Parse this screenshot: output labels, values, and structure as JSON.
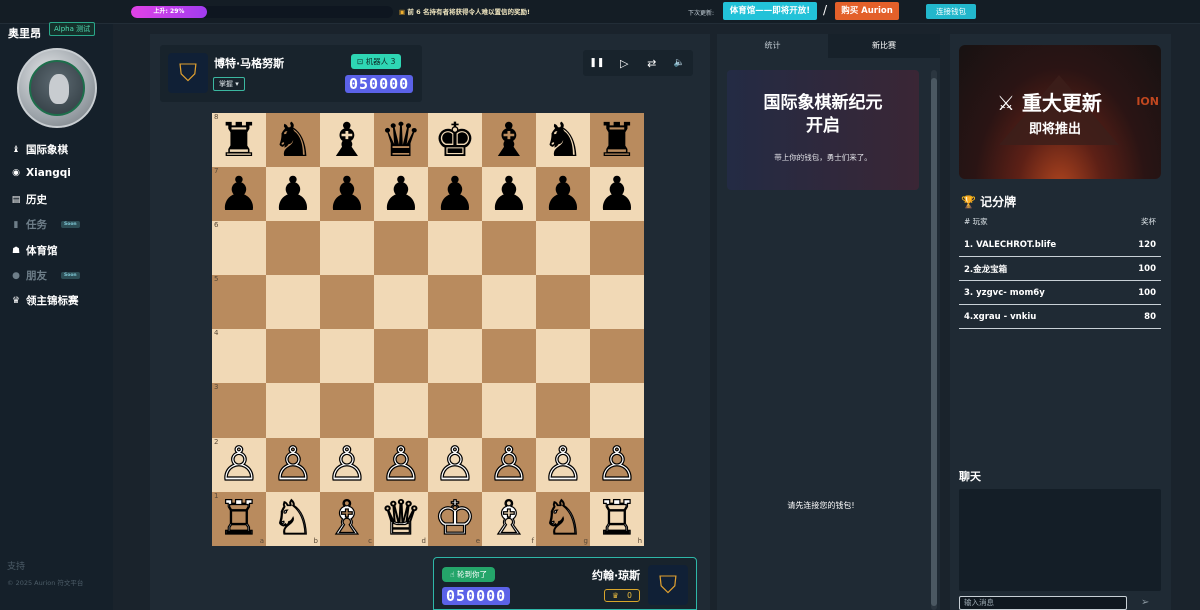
{
  "topbar": {
    "progress_label": "上升: 29%",
    "progress_value": 0.29,
    "notice": "前 6 名持有者将获得令人难以置信的奖励!",
    "next_update_label": "下次更新:",
    "gym_button": "体育馆——即将开放!",
    "slash": "/",
    "buy_button": "购买 Aurion",
    "connect_wallet": "连接钱包"
  },
  "sidebar": {
    "brand": "奥里昂",
    "alpha_badge": "Alpha 测试",
    "items": [
      {
        "icon": "♝",
        "label": "国际象棋",
        "dim": false
      },
      {
        "icon": "◉",
        "label": "Xiangqi",
        "dim": false
      },
      {
        "icon": "▤",
        "label": "历史",
        "dim": false
      },
      {
        "icon": "▮",
        "label": "任务",
        "dim": true,
        "soon": "Soon"
      },
      {
        "icon": "☗",
        "label": "体育馆",
        "dim": false
      },
      {
        "icon": "●",
        "label": "朋友",
        "dim": true,
        "soon": "Soon"
      },
      {
        "icon": "♛",
        "label": "领主锦标赛",
        "dim": false
      }
    ],
    "support": "支持",
    "copyright": "© 2025 Aurion 符文平台"
  },
  "opponent": {
    "name": "博特·马格努斯",
    "dropdown": "掌握 ▾",
    "bot_badge": "机器人 3",
    "score": "050000"
  },
  "controls": {
    "pause": "❚❚",
    "play": "▷",
    "flip": "⇄",
    "sound": "🔈"
  },
  "board": {
    "ranks": [
      "8",
      "7",
      "6",
      "5",
      "4",
      "3",
      "2",
      "1"
    ],
    "files": [
      "a",
      "b",
      "c",
      "d",
      "e",
      "f",
      "g",
      "h"
    ],
    "rows": [
      [
        "♜",
        "♞",
        "♝",
        "♛",
        "♚",
        "♝",
        "♞",
        "♜"
      ],
      [
        "♟",
        "♟",
        "♟",
        "♟",
        "♟",
        "♟",
        "♟",
        "♟"
      ],
      [
        "",
        "",
        "",
        "",
        "",
        "",
        "",
        ""
      ],
      [
        "",
        "",
        "",
        "",
        "",
        "",
        "",
        ""
      ],
      [
        "",
        "",
        "",
        "",
        "",
        "",
        "",
        ""
      ],
      [
        "",
        "",
        "",
        "",
        "",
        "",
        "",
        ""
      ],
      [
        "♙",
        "♙",
        "♙",
        "♙",
        "♙",
        "♙",
        "♙",
        "♙"
      ],
      [
        "♖",
        "♘",
        "♗",
        "♕",
        "♔",
        "♗",
        "♘",
        "♖"
      ]
    ]
  },
  "player": {
    "name": "约翰·琼斯",
    "turn_badge": "轮到你了",
    "score": "050000",
    "trophies": "0"
  },
  "mid": {
    "tab_stats": "统计",
    "tab_new_game": "新比赛",
    "news_title": "国际象棋新纪元开启",
    "news_sub": "带上你的钱包，勇士们来了。",
    "connect_msg": "请先连接您的钱包!"
  },
  "right": {
    "banner_title": "重大更新",
    "banner_sub": "即将推出",
    "banner_ion": "ION",
    "leaderboard_title": "记分牌",
    "col_player": "# 玩家",
    "col_trophy": "奖杯",
    "rows": [
      {
        "name": "1. VALECHROT.blife",
        "score": "120"
      },
      {
        "name": "2.金龙宝箱",
        "score": "100"
      },
      {
        "name": "3. yzgvc- mom6y",
        "score": "100"
      },
      {
        "name": "4.xgrau - vnkiu",
        "score": "80"
      }
    ],
    "chat_title": "聊天",
    "chat_placeholder": "输入消息"
  }
}
